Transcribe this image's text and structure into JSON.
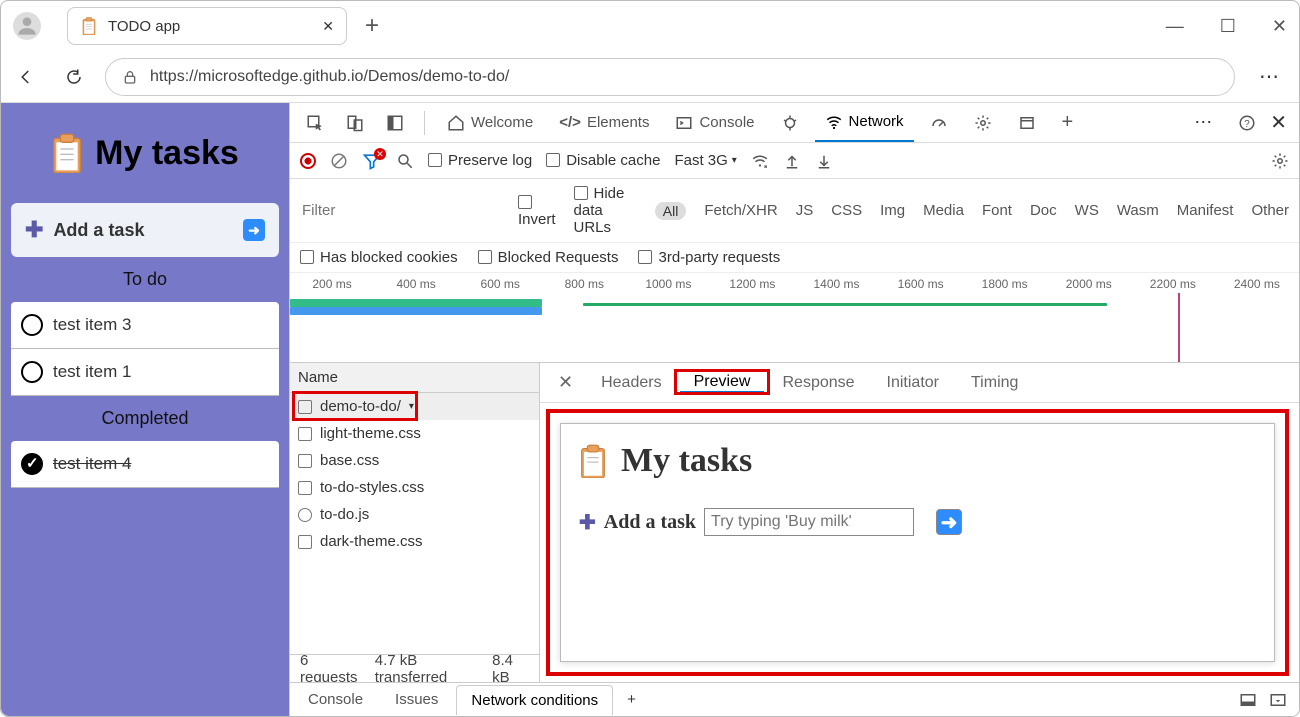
{
  "browser": {
    "tab_title": "TODO app",
    "url": "https://microsoftedge.github.io/Demos/demo-to-do/"
  },
  "app": {
    "title": "My tasks",
    "add_label": "Add a task",
    "sections": {
      "todo": "To do",
      "completed": "Completed"
    },
    "todo_items": [
      "test item 3",
      "test item 1"
    ],
    "completed_items": [
      "test item 4"
    ]
  },
  "devtools": {
    "tabs": [
      "Welcome",
      "Elements",
      "Console",
      "Network"
    ],
    "active_tab": "Network",
    "toolbar": {
      "preserve_log": "Preserve log",
      "disable_cache": "Disable cache",
      "throttle": "Fast 3G"
    },
    "filters": {
      "placeholder": "Filter",
      "invert": "Invert",
      "hide_data": "Hide data URLs",
      "all": "All",
      "types": [
        "Fetch/XHR",
        "JS",
        "CSS",
        "Img",
        "Media",
        "Font",
        "Doc",
        "WS",
        "Wasm",
        "Manifest",
        "Other"
      ]
    },
    "blocked": {
      "cookies": "Has blocked cookies",
      "requests": "Blocked Requests",
      "third": "3rd-party requests"
    },
    "timeline_ticks": [
      "200 ms",
      "400 ms",
      "600 ms",
      "800 ms",
      "1000 ms",
      "1200 ms",
      "1400 ms",
      "1600 ms",
      "1800 ms",
      "2000 ms",
      "2200 ms",
      "2400 ms"
    ],
    "requests": {
      "header": "Name",
      "items": [
        "demo-to-do/",
        "light-theme.css",
        "base.css",
        "to-do-styles.css",
        "to-do.js",
        "dark-theme.css"
      ],
      "selected": 0
    },
    "preview_tabs": [
      "Headers",
      "Preview",
      "Response",
      "Initiator",
      "Timing"
    ],
    "preview_active": "Preview",
    "preview": {
      "title": "My tasks",
      "add_label": "Add a task",
      "placeholder": "Try typing 'Buy milk'"
    },
    "status": {
      "requests": "6 requests",
      "transferred": "4.7 kB transferred",
      "resources": "8.4 kB"
    },
    "drawer": {
      "tabs": [
        "Console",
        "Issues",
        "Network conditions"
      ],
      "active": "Network conditions"
    }
  }
}
